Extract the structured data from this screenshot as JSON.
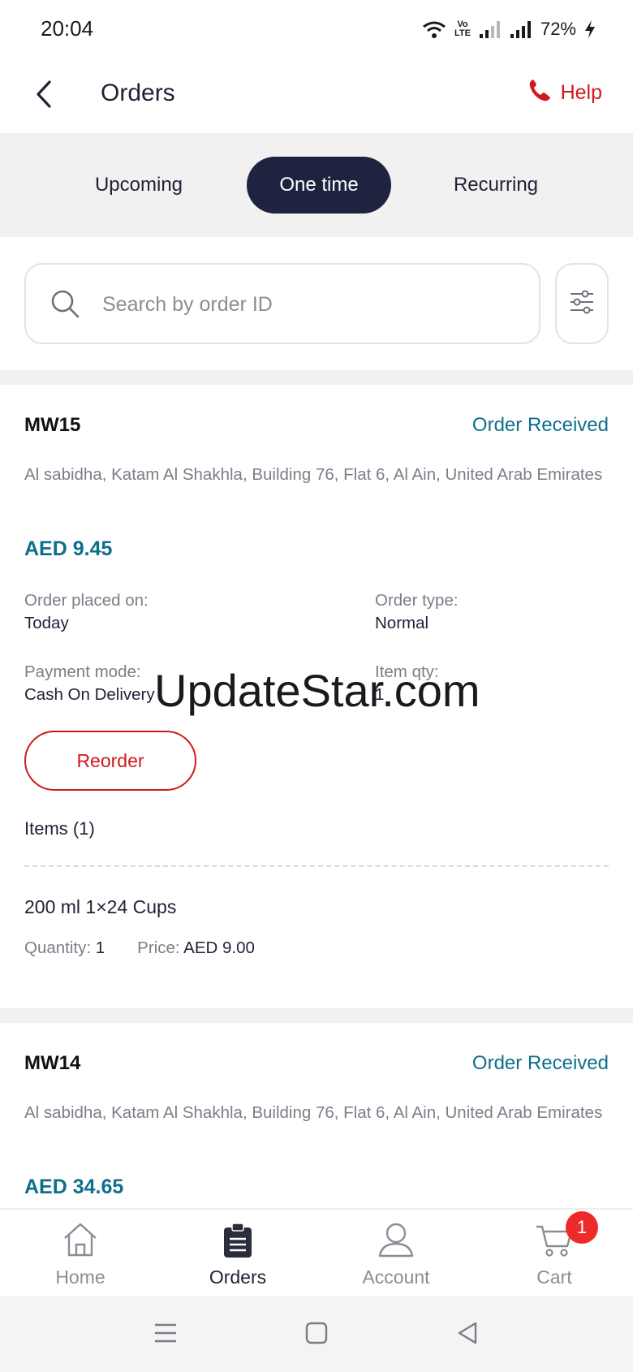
{
  "status_bar": {
    "time": "20:04",
    "volte_line1": "Vo",
    "volte_line2": "LTE",
    "battery": "72%"
  },
  "header": {
    "title": "Orders",
    "help_label": "Help",
    "icons": {
      "back": "chevron-left-icon",
      "help": "phone-icon"
    }
  },
  "tabs": [
    {
      "label": "Upcoming",
      "active": false
    },
    {
      "label": "One time",
      "active": true
    },
    {
      "label": "Recurring",
      "active": false
    }
  ],
  "search": {
    "placeholder": "Search by order ID",
    "value": ""
  },
  "orders": [
    {
      "id": "MW15",
      "status": "Order Received",
      "address": "Al sabidha, Katam Al Shakhla, Building 76, Flat 6, Al Ain, United Arab Emirates",
      "total": "AED 9.45",
      "placed_label": "Order placed on:",
      "placed_value": "Today",
      "type_label": "Order type:",
      "type_value": "Normal",
      "payment_label": "Payment mode:",
      "payment_value": "Cash On Delivery",
      "qty_label": "Item qty:",
      "qty_value": "1",
      "reorder_label": "Reorder",
      "items_heading": "Items (1)",
      "items": [
        {
          "name": "200 ml 1×24 Cups",
          "quantity_label": "Quantity:",
          "quantity_value": "1",
          "price_label": "Price:",
          "price_value": "AED 9.00"
        }
      ]
    },
    {
      "id": "MW14",
      "status": "Order Received",
      "address": "Al sabidha, Katam Al Shakhla, Building 76, Flat 6, Al Ain, United Arab Emirates",
      "total": "AED 34.65"
    }
  ],
  "watermark": "UpdateStar.com",
  "bottom_nav": [
    {
      "label": "Home",
      "icon": "home-icon",
      "active": false
    },
    {
      "label": "Orders",
      "icon": "clipboard-icon",
      "active": true
    },
    {
      "label": "Account",
      "icon": "user-icon",
      "active": false
    },
    {
      "label": "Cart",
      "icon": "cart-icon",
      "active": false,
      "badge": "1"
    }
  ],
  "colors": {
    "accent_red": "#d0191c",
    "accent_teal": "#0d6e8e",
    "navy": "#1e2440"
  }
}
